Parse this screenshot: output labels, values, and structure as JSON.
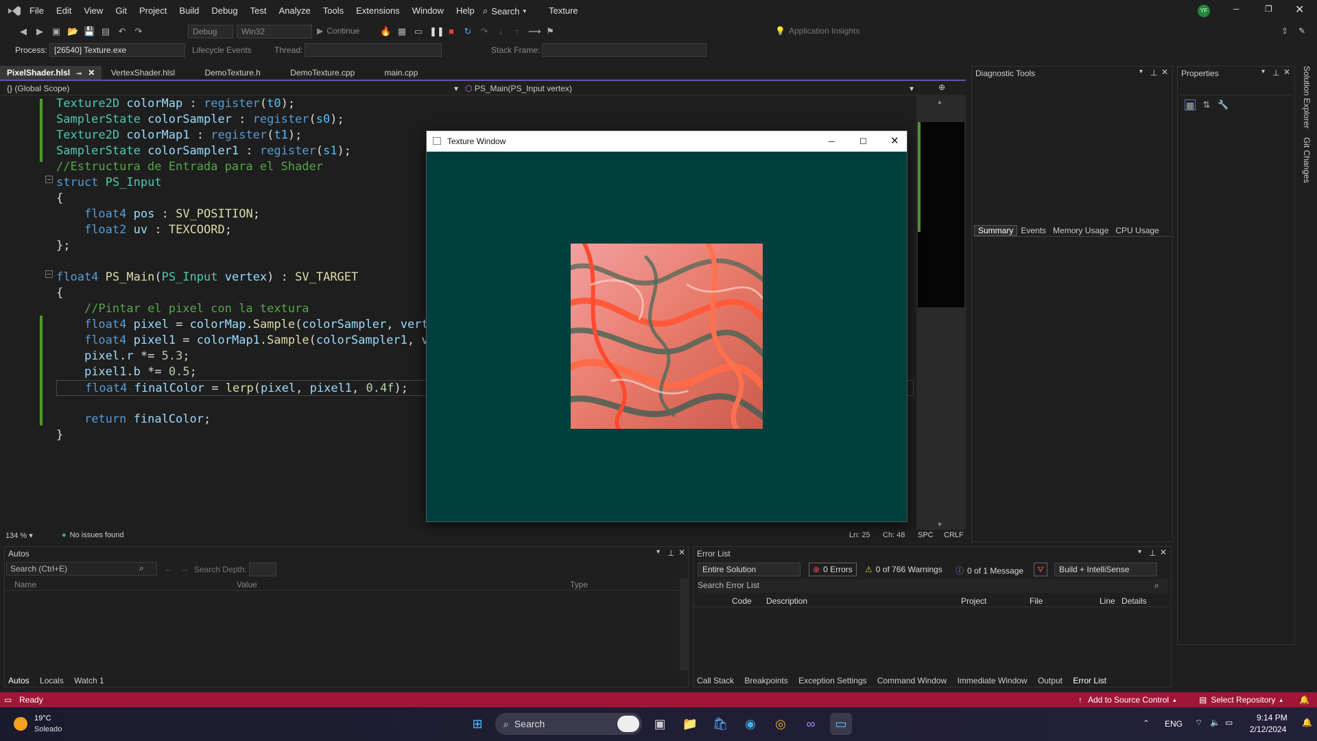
{
  "titlebar": {
    "menu": [
      "File",
      "Edit",
      "View",
      "Git",
      "Project",
      "Build",
      "Debug",
      "Test",
      "Analyze",
      "Tools",
      "Extensions",
      "Window",
      "Help"
    ],
    "search_label": "Search",
    "solution_name": "Texture",
    "avatar_initials": "YF"
  },
  "toolbar": {
    "config": "Debug",
    "platform": "Win32",
    "continue_label": "Continue",
    "app_insights": "Application Insights",
    "process_label": "Process:",
    "process_value": "[26540] Texture.exe",
    "lifecycle_label": "Lifecycle Events",
    "thread_label": "Thread:",
    "stack_label": "Stack Frame:"
  },
  "editor": {
    "tabs": [
      "PixelShader.hlsl",
      "VertexShader.hlsl",
      "DemoTexture.h",
      "DemoTexture.cpp",
      "main.cpp"
    ],
    "scope": "(Global Scope)",
    "function": "PS_Main(PS_Input vertex)",
    "zoom": "134 %",
    "issues": "No issues found",
    "ln": "Ln: 25",
    "ch": "Ch: 48",
    "spc": "SPC",
    "crlf": "CRLF"
  },
  "texture_window": {
    "title": "Texture Window"
  },
  "diagnostic": {
    "title": "Diagnostic Tools",
    "tabs": [
      "Summary",
      "Events",
      "Memory Usage",
      "CPU Usage"
    ]
  },
  "properties": {
    "title": "Properties"
  },
  "side_tabs": [
    "Solution Explorer",
    "Git Changes"
  ],
  "autos": {
    "title": "Autos",
    "search": "Search (Ctrl+E)",
    "depth": "Search Depth:",
    "columns": [
      "Name",
      "Value",
      "Type"
    ],
    "tabs": [
      "Autos",
      "Locals",
      "Watch 1"
    ]
  },
  "errors": {
    "title": "Error List",
    "scope": "Entire Solution",
    "errors": "0 Errors",
    "warnings": "0 of 766 Warnings",
    "messages": "0 of 1 Message",
    "build": "Build + IntelliSense",
    "search": "Search Error List",
    "columns": [
      "Code",
      "Description",
      "Project",
      "File",
      "Line",
      "Details"
    ],
    "tabs": [
      "Call Stack",
      "Breakpoints",
      "Exception Settings",
      "Command Window",
      "Immediate Window",
      "Output",
      "Error List"
    ]
  },
  "status": {
    "ready": "Ready",
    "source_control": "Add to Source Control",
    "repo": "Select Repository"
  },
  "taskbar": {
    "temp": "19°C",
    "weather": "Soleado",
    "search": "Search",
    "lang": "ENG",
    "time": "9:14 PM",
    "date": "2/12/2024"
  }
}
